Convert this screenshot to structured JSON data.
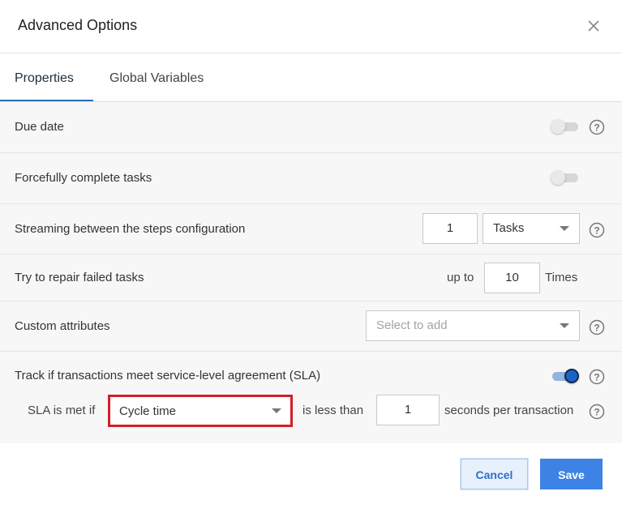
{
  "dialog": {
    "title": "Advanced Options"
  },
  "tabs": [
    {
      "label": "Properties",
      "active": true
    },
    {
      "label": "Global Variables",
      "active": false
    }
  ],
  "rows": {
    "due_date": {
      "label": "Due date",
      "toggle_on": false
    },
    "force_complete": {
      "label": "Forcefully complete tasks",
      "toggle_on": false
    },
    "streaming": {
      "label": "Streaming between the steps configuration",
      "value": "1",
      "unit_selected": "Tasks"
    },
    "repair": {
      "label": "Try to repair failed tasks",
      "prefix": "up to",
      "value": "10",
      "suffix": "Times"
    },
    "custom_attributes": {
      "label": "Custom attributes",
      "placeholder": "Select to add"
    },
    "sla": {
      "label": "Track if transactions meet service-level agreement (SLA)",
      "toggle_on": true,
      "met_if_label": "SLA is met if",
      "metric_selected": "Cycle time",
      "comparison_label": "is less than",
      "value": "1",
      "unit_label": "seconds per transaction"
    }
  },
  "footer": {
    "cancel_label": "Cancel",
    "save_label": "Save"
  },
  "colors": {
    "accent": "#3d83e6",
    "tab_underline": "#2d6fb8",
    "highlight_border": "#d21f2a",
    "toggle_on": "#1c63c6"
  },
  "icons": {
    "close": "close-icon",
    "help": "help-circle-icon",
    "caret": "caret-down-icon"
  }
}
